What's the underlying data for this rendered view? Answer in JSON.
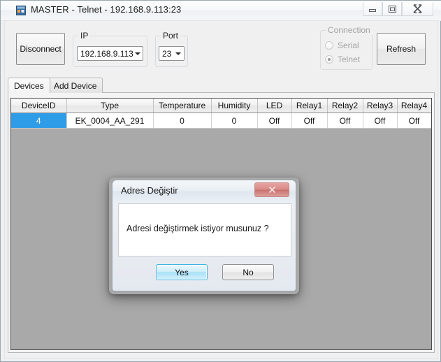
{
  "window": {
    "title": "MASTER - Telnet - 192.168.9.113:23",
    "icon": "form-app-icon",
    "controls": {
      "minimize": "–",
      "maximize": "□",
      "close": "✕"
    }
  },
  "toolbar": {
    "disconnect_label": "Disconnect",
    "refresh_label": "Refresh",
    "ip_group_label": "IP",
    "ip_value": "192.168.9.113",
    "port_group_label": "Port",
    "port_value": "23",
    "connection_group_label": "Connection",
    "radio_serial_label": "Serial",
    "radio_telnet_label": "Telnet",
    "selected_connection": "Telnet"
  },
  "tabs": [
    {
      "label": "Devices",
      "active": true
    },
    {
      "label": "Add Device",
      "active": false
    }
  ],
  "grid": {
    "columns": [
      "DeviceID",
      "Type",
      "Temperature",
      "Humidity",
      "LED",
      "Relay1",
      "Relay2",
      "Relay3",
      "Relay4"
    ],
    "rows": [
      {
        "DeviceID": "4",
        "Type": "EK_0004_AA_291",
        "Temperature": "0",
        "Humidity": "0",
        "LED": "Off",
        "Relay1": "Off",
        "Relay2": "Off",
        "Relay3": "Off",
        "Relay4": "Off"
      }
    ],
    "selected_cell": "DeviceID",
    "selection_color": "#2f9ce8"
  },
  "dialog": {
    "title": "Adres Değiştir",
    "message": "Adresi değiştirmek istiyor musunuz ?",
    "yes_label": "Yes",
    "no_label": "No",
    "close_label": "✕",
    "close_color": "#c9716e",
    "default_button": "Yes"
  }
}
